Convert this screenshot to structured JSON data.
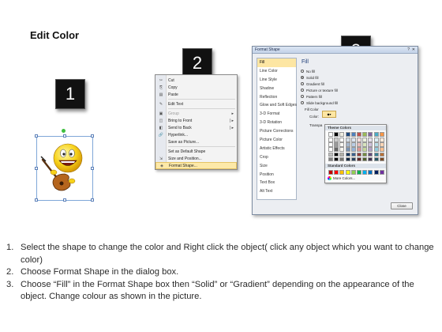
{
  "title": "Edit Color",
  "steps": {
    "one": "1",
    "two": "2",
    "three": "3"
  },
  "context_menu": {
    "items": [
      {
        "icon": "✂",
        "label": "Cut",
        "submenu": false,
        "disabled": false,
        "highlighted": false
      },
      {
        "icon": "⎘",
        "label": "Copy",
        "submenu": false,
        "disabled": false,
        "highlighted": false
      },
      {
        "icon": "▤",
        "label": "Paste",
        "submenu": false,
        "disabled": false,
        "highlighted": false
      },
      {
        "icon": "✎",
        "label": "Edit Text",
        "submenu": false,
        "disabled": false,
        "highlighted": false
      },
      {
        "icon": "▣",
        "label": "Group",
        "submenu": true,
        "disabled": true,
        "highlighted": false
      },
      {
        "icon": "◫",
        "label": "Bring to Front",
        "submenu": true,
        "disabled": false,
        "highlighted": false
      },
      {
        "icon": "◧",
        "label": "Send to Back",
        "submenu": true,
        "disabled": false,
        "highlighted": false
      },
      {
        "icon": "🔗",
        "label": "Hyperlink...",
        "submenu": false,
        "disabled": false,
        "highlighted": false
      },
      {
        "icon": "",
        "label": "Save as Picture...",
        "submenu": false,
        "disabled": false,
        "highlighted": false
      },
      {
        "icon": "",
        "label": "Set as Default Shape",
        "submenu": false,
        "disabled": false,
        "highlighted": false
      },
      {
        "icon": "⇲",
        "label": "Size and Position...",
        "submenu": false,
        "disabled": false,
        "highlighted": false
      },
      {
        "icon": "◈",
        "label": "Format Shape...",
        "submenu": false,
        "disabled": false,
        "highlighted": true
      }
    ]
  },
  "dialog": {
    "title": "Format Shape",
    "help": "?",
    "close_x": "✕",
    "categories": [
      "Fill",
      "Line Color",
      "Line Style",
      "Shadow",
      "Reflection",
      "Glow and Soft Edges",
      "3-D Format",
      "3-D Rotation",
      "Picture Corrections",
      "Picture Color",
      "Artistic Effects",
      "Crop",
      "Size",
      "Position",
      "Text Box",
      "Alt Text"
    ],
    "selected_category": "Fill",
    "fill_heading": "Fill",
    "fill_options": [
      {
        "label": "No fill",
        "checked": false
      },
      {
        "label": "Solid fill",
        "checked": true
      },
      {
        "label": "Gradient fill",
        "checked": false
      },
      {
        "label": "Picture or texture fill",
        "checked": false
      },
      {
        "label": "Pattern fill",
        "checked": false
      },
      {
        "label": "Slide background fill",
        "checked": false
      }
    ],
    "fill_color_label": "Fill Color",
    "color_label": "Color:",
    "transparency_label": "Transpa",
    "close_button": "Close"
  },
  "color_picker": {
    "theme_heading": "Theme Colors",
    "standard_heading": "Standard Colors",
    "more_colors": "More Colors...",
    "theme_top_row": [
      "#ffffff",
      "#000000",
      "#eeece1",
      "#1f497d",
      "#4f81bd",
      "#c0504d",
      "#9bbb59",
      "#8064a2",
      "#4bacc6",
      "#f79646"
    ],
    "standard_colors": [
      "#c00000",
      "#ff0000",
      "#ffc000",
      "#ffff00",
      "#92d050",
      "#00b050",
      "#00b0f0",
      "#0070c0",
      "#002060",
      "#7030a0"
    ]
  },
  "instructions": [
    {
      "num": "1.",
      "text": "Select the shape to change the color and Right click the object( click any object which you want to change color)"
    },
    {
      "num": "2.",
      "text": "Choose Format Shape in the dialog box."
    },
    {
      "num": "3.",
      "text": "Choose “Fill” in the Format Shape box then “Solid” or “Gradient” depending on the appearance of the object. Change colour as shown in the picture."
    }
  ]
}
